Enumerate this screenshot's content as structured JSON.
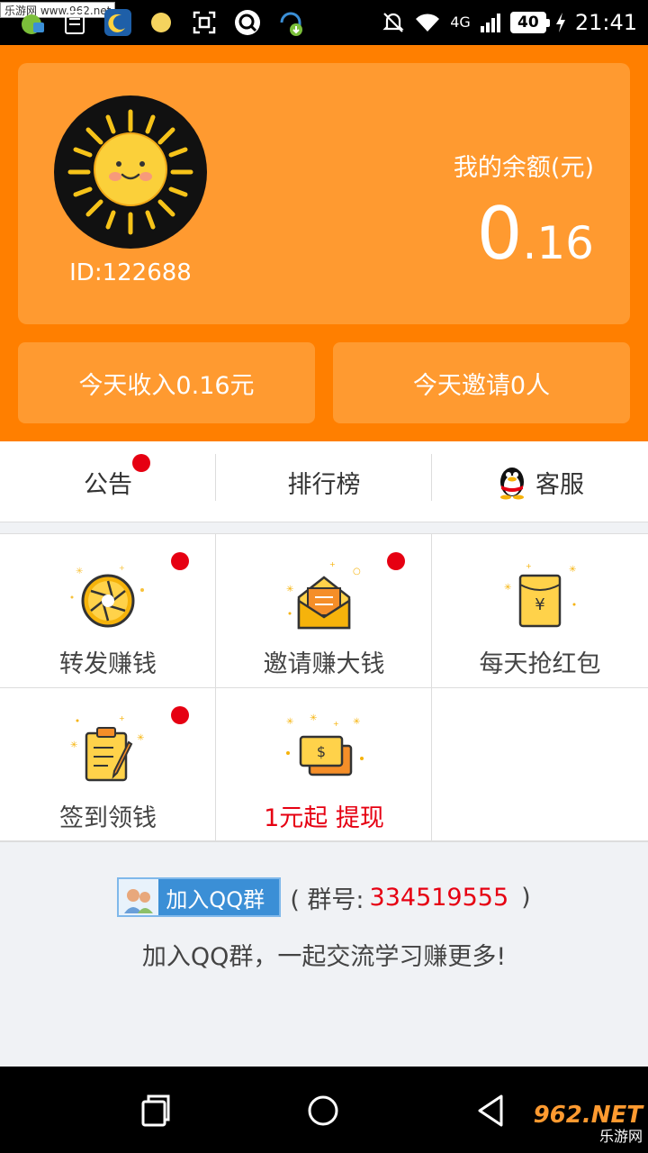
{
  "statusbar": {
    "watermark": "乐游网 www.962.net",
    "signal_label": "4G",
    "battery": "40",
    "time": "21:41"
  },
  "profile": {
    "user_id": "ID:122688",
    "balance_label": "我的余额(元)",
    "balance_integer": "0",
    "balance_decimal": ".16"
  },
  "stats": {
    "today_income": "今天收入0.16元",
    "today_invites": "今天邀请0人"
  },
  "tabs": [
    {
      "label": "公告",
      "badge": true
    },
    {
      "label": "排行榜",
      "badge": false
    },
    {
      "label": "客服",
      "icon": "qq-penguin-icon",
      "badge": false
    }
  ],
  "grid": [
    {
      "label": "转发赚钱",
      "icon": "aperture-icon",
      "badge": true
    },
    {
      "label": "邀请赚大钱",
      "icon": "envelope-icon",
      "badge": true
    },
    {
      "label": "每天抢红包",
      "icon": "red-packet-icon",
      "badge": false
    },
    {
      "label": "签到领钱",
      "icon": "clipboard-icon",
      "badge": true
    },
    {
      "label": "1元起 提现",
      "icon": "cash-icon",
      "badge": false,
      "highlight": true
    }
  ],
  "qq_group": {
    "button_label": "加入QQ群",
    "prefix": "( 群号:",
    "number": "334519555",
    "suffix": ")",
    "tip": "加入QQ群，一起交流学习赚更多!"
  },
  "navbar": {
    "watermark_top": "962.NET",
    "watermark_bottom": "乐游网"
  },
  "colors": {
    "brand_orange": "#ff7f00",
    "card_orange": "#ff9a30",
    "badge_red": "#e60012"
  }
}
